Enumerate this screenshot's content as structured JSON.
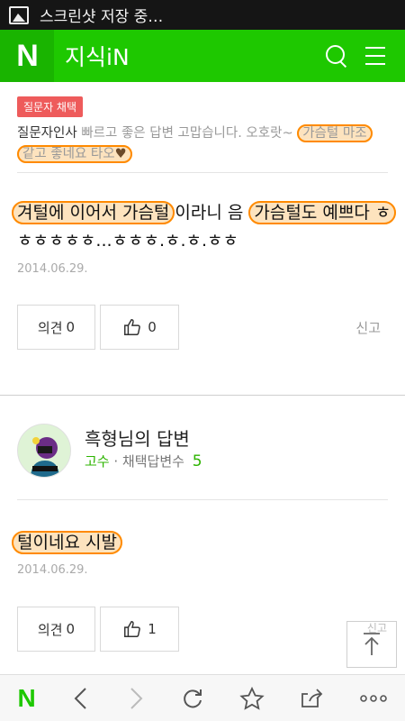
{
  "status_bar": {
    "text": "스크린샷 저장 중…",
    "icon": "image-icon"
  },
  "header": {
    "logo": "N",
    "title": "지식iN",
    "icons": [
      "search-icon",
      "menu-icon"
    ],
    "color": "#1ec800"
  },
  "comment": {
    "badge": "질문자 채택",
    "author": "질문자인사",
    "text_plain": "빠르고 좋은 답변 고맙습니다. 오호랏~",
    "text_hl1": "가슴털 마조",
    "text_hl2": "같고 좋네요 타오",
    "emoji": "heart"
  },
  "answer1": {
    "hl1": "겨털에 이어서 가슴털",
    "mid": "이라니 음",
    "hl2": "가슴털도 예쁘다 ㅎ",
    "line2": "ㅎㅎㅎㅎㅎ...ㅎㅎㅎ.ㅎ.ㅎ.ㅎㅎ",
    "date": "2014.06.29.",
    "opinion_label": "의견",
    "opinion_count": "0",
    "like_count": "0",
    "report_label": "신고"
  },
  "answer2": {
    "author_name": "흑형님의 답변",
    "rank": "고수",
    "meta_label": "· 채택답변수",
    "adopted_count": "5",
    "text_hl": "털이네요 시발",
    "date": "2014.06.29.",
    "opinion_label": "의견",
    "opinion_count": "0",
    "like_count": "1",
    "report_label": "신고"
  },
  "bottom_bar": {
    "logo": "N",
    "icons": [
      "back-icon",
      "forward-icon",
      "refresh-icon",
      "bookmark-star-icon",
      "share-icon",
      "more-icon"
    ]
  },
  "colors": {
    "accent": "#1ec800",
    "highlight_border": "#ff8a00",
    "highlight_fill": "#fde3be",
    "badge": "#ee5b5b"
  }
}
